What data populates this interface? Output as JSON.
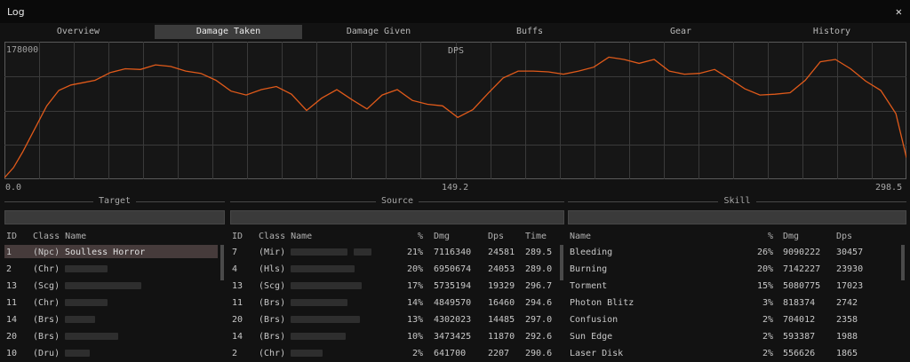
{
  "window": {
    "title": "Log",
    "close_icon": "close-icon"
  },
  "tabs": [
    {
      "label": "Overview"
    },
    {
      "label": "Damage Taken",
      "active": true
    },
    {
      "label": "Damage Given"
    },
    {
      "label": "Buffs"
    },
    {
      "label": "Gear"
    },
    {
      "label": "History"
    }
  ],
  "chart_data": {
    "type": "line",
    "title": "DPS",
    "y_max_label": "178000",
    "x_labels": [
      "0.0",
      "149.2",
      "298.5"
    ],
    "xlim": [
      0,
      298.5
    ],
    "ylim": [
      0,
      178000
    ],
    "grid": true,
    "series": [
      {
        "color": "#e05a1a",
        "x": [
          0,
          3,
          6,
          10,
          14,
          18,
          22,
          26,
          30,
          35,
          40,
          45,
          50,
          55,
          60,
          65,
          70,
          75,
          80,
          85,
          90,
          95,
          100,
          105,
          110,
          115,
          120,
          125,
          130,
          135,
          140,
          145,
          150,
          155,
          160,
          165,
          170,
          175,
          180,
          185,
          190,
          195,
          200,
          205,
          210,
          215,
          220,
          225,
          230,
          235,
          240,
          245,
          250,
          255,
          260,
          265,
          270,
          275,
          280,
          285,
          290,
          295,
          298.5
        ],
        "y": [
          2000,
          15000,
          35000,
          65000,
          95000,
          115000,
          122000,
          125000,
          128000,
          138000,
          143000,
          142000,
          148000,
          146000,
          140000,
          137000,
          128000,
          114000,
          109000,
          116000,
          120000,
          110000,
          89000,
          105000,
          116000,
          103000,
          91000,
          109000,
          116000,
          102000,
          97000,
          95000,
          80000,
          90000,
          111000,
          131000,
          140000,
          140000,
          139000,
          136000,
          140000,
          145000,
          158000,
          155000,
          150000,
          155000,
          140000,
          136000,
          137000,
          142000,
          130000,
          117000,
          109000,
          110000,
          112000,
          128000,
          152000,
          155000,
          143000,
          127000,
          115000,
          85000,
          28000
        ]
      }
    ]
  },
  "sections": {
    "target": "Target",
    "source": "Source",
    "skill": "Skill"
  },
  "target_table": {
    "headers": {
      "id": "ID",
      "class_name": "Class Name"
    },
    "rows": [
      {
        "id": "1",
        "class": "(Npc)",
        "name": "Soulless Horror"
      },
      {
        "id": "2",
        "class": "(Chr)"
      },
      {
        "id": "13",
        "class": "(Scg)"
      },
      {
        "id": "11",
        "class": "(Chr)"
      },
      {
        "id": "14",
        "class": "(Brs)"
      },
      {
        "id": "20",
        "class": "(Brs)"
      },
      {
        "id": "10",
        "class": "(Dru)"
      }
    ]
  },
  "source_table": {
    "headers": {
      "id": "ID",
      "class_name": "Class Name",
      "pct": "%",
      "dmg": "Dmg",
      "dps": "Dps",
      "time": "Time"
    },
    "rows": [
      {
        "id": "7",
        "class": "(Mir)",
        "pct": "21%",
        "dmg": "7116340",
        "dps": "24581",
        "time": "289.5"
      },
      {
        "id": "4",
        "class": "(Hls)",
        "pct": "20%",
        "dmg": "6950674",
        "dps": "24053",
        "time": "289.0"
      },
      {
        "id": "13",
        "class": "(Scg)",
        "pct": "17%",
        "dmg": "5735194",
        "dps": "19329",
        "time": "296.7"
      },
      {
        "id": "11",
        "class": "(Brs)",
        "pct": "14%",
        "dmg": "4849570",
        "dps": "16460",
        "time": "294.6"
      },
      {
        "id": "20",
        "class": "(Brs)",
        "pct": "13%",
        "dmg": "4302023",
        "dps": "14485",
        "time": "297.0"
      },
      {
        "id": "14",
        "class": "(Brs)",
        "pct": "10%",
        "dmg": "3473425",
        "dps": "11870",
        "time": "292.6"
      },
      {
        "id": "2",
        "class": "(Chr)",
        "pct": "2%",
        "dmg": "641700",
        "dps": "2207",
        "time": "290.6"
      }
    ]
  },
  "skill_table": {
    "headers": {
      "name": "Name",
      "pct": "%",
      "dmg": "Dmg",
      "dps": "Dps"
    },
    "rows": [
      {
        "name": "Bleeding",
        "pct": "26%",
        "dmg": "9090222",
        "dps": "30457"
      },
      {
        "name": "Burning",
        "pct": "20%",
        "dmg": "7142227",
        "dps": "23930"
      },
      {
        "name": "Torment",
        "pct": "15%",
        "dmg": "5080775",
        "dps": "17023"
      },
      {
        "name": "Photon Blitz",
        "pct": "3%",
        "dmg": "818374",
        "dps": "2742"
      },
      {
        "name": "Confusion",
        "pct": "2%",
        "dmg": "704012",
        "dps": "2358"
      },
      {
        "name": "Sun Edge",
        "pct": "2%",
        "dmg": "593387",
        "dps": "1988"
      },
      {
        "name": "Laser Disk",
        "pct": "2%",
        "dmg": "556626",
        "dps": "1865"
      }
    ]
  }
}
